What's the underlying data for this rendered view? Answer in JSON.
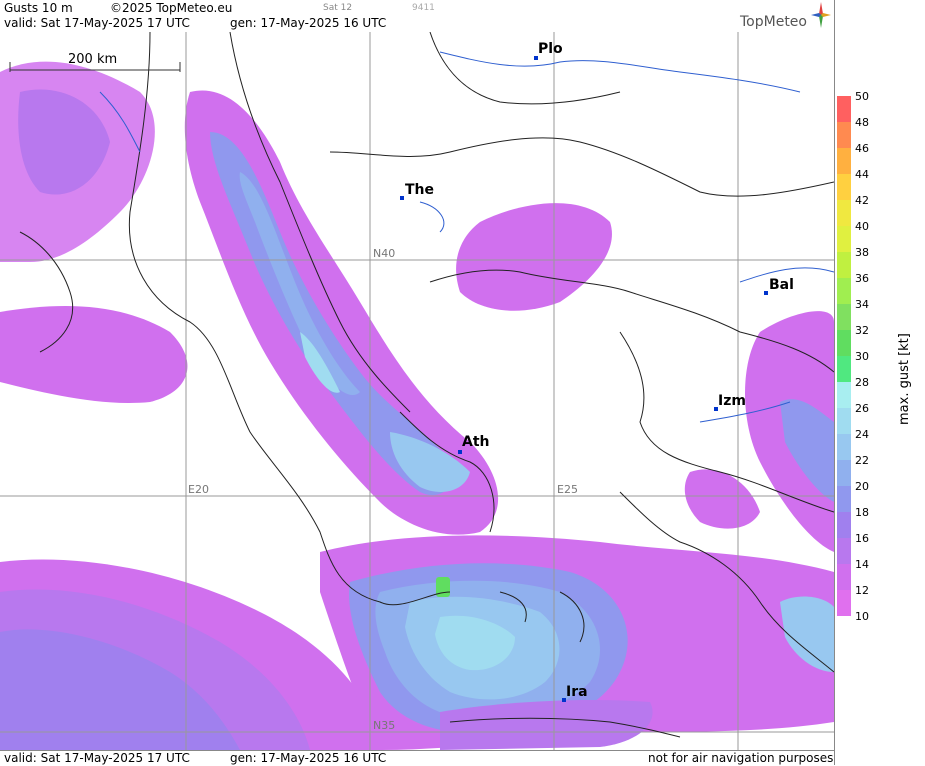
{
  "header": {
    "title": "Gusts 10 m",
    "copyright": "©2025 TopMeteo.eu",
    "valid": "valid:  Sat  17-May-2025  17 UTC",
    "gen": "gen: 17-May-2025 16 UTC",
    "sat": "Sat 12",
    "code": "9411",
    "brand": "TopMeteo"
  },
  "footer": {
    "valid": "valid:  Sat  17-May-2025  17 UTC",
    "gen": "gen: 17-May-2025 16 UTC",
    "note": "not for air navigation purposes"
  },
  "map": {
    "scale_label": "200 km",
    "grid_labels": {
      "n40": "N40",
      "n35": "N35",
      "e20": "E20",
      "e25": "E25"
    },
    "cities": {
      "plo": "Plo",
      "the": "The",
      "bal": "Bal",
      "izm": "Izm",
      "ath": "Ath",
      "ira": "Ira"
    }
  },
  "legend": {
    "title": "max. gust [kt]",
    "ticks": [
      "50",
      "48",
      "46",
      "44",
      "42",
      "40",
      "38",
      "36",
      "34",
      "32",
      "30",
      "28",
      "26",
      "24",
      "22",
      "20",
      "18",
      "16",
      "14",
      "12",
      "10"
    ],
    "colors": [
      "#ff6060",
      "#ff8a50",
      "#ffb040",
      "#ffd040",
      "#f0e840",
      "#e0f040",
      "#c0f040",
      "#a0ee50",
      "#80e060",
      "#60dd60",
      "#50e880",
      "#a8eef0",
      "#a0dcf0",
      "#98c8f0",
      "#90b0ee",
      "#9098ee",
      "#a080ee",
      "#b878ee",
      "#d070ee",
      "#e070ee"
    ],
    "colors_meaning": "bins top (48-50) to bottom (12-14)"
  }
}
